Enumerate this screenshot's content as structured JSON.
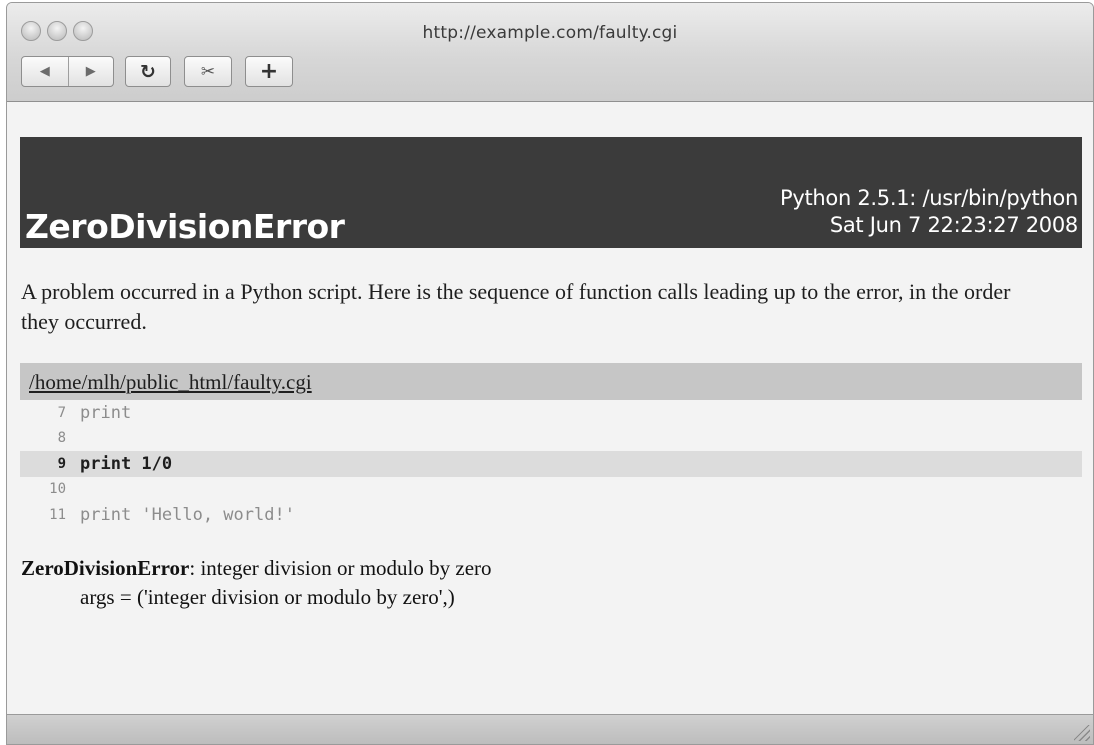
{
  "window": {
    "title": "http://example.com/faulty.cgi"
  },
  "toolbar": {
    "back_icon": "◀",
    "forward_icon": "▶",
    "reload_icon": "↻",
    "clip_icon": "✂",
    "add_icon": "+"
  },
  "banner": {
    "title": "ZeroDivisionError",
    "python_info": "Python 2.5.1: /usr/bin/python",
    "timestamp": "Sat Jun 7 22:23:27 2008"
  },
  "intro": "A problem occurred in a Python script. Here is the sequence of function calls leading up to the error, in the order they occurred.",
  "frame": {
    "file": "/home/mlh/public_html/faulty.cgi",
    "lines": [
      {
        "num": "7",
        "code": "print",
        "highlight": false
      },
      {
        "num": "8",
        "code": "",
        "highlight": false
      },
      {
        "num": "9",
        "code": "print 1/0",
        "highlight": true
      },
      {
        "num": "10",
        "code": "",
        "highlight": false
      },
      {
        "num": "11",
        "code": "print 'Hello, world!'",
        "highlight": false
      }
    ]
  },
  "error": {
    "name": "ZeroDivisionError",
    "message": ": integer division or modulo by zero",
    "args": "args = ('integer division or modulo by zero',)"
  },
  "colors": {
    "banner_bg": "#3b3b3b",
    "filebar_bg": "#c6c6c6",
    "highlight_bg": "#dcdcdc"
  }
}
